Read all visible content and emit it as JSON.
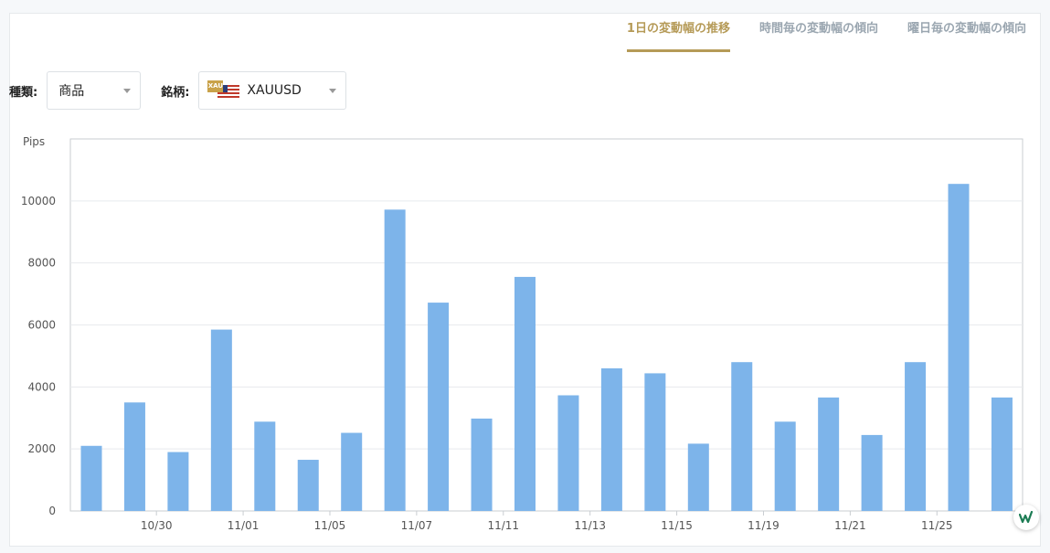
{
  "tabs": [
    {
      "label": "1日の変動幅の推移",
      "active": true
    },
    {
      "label": "時間毎の変動幅の傾向",
      "active": false
    },
    {
      "label": "曜日毎の変動幅の傾向",
      "active": false
    }
  ],
  "filters": {
    "type_label": "種類:",
    "type_value": "商品",
    "symbol_label": "銘柄:",
    "symbol_value": "XAUUSD",
    "symbol_badge": "XAU"
  },
  "colors": {
    "bar": "#7db4ea",
    "accent": "#b59a57"
  },
  "chart_data": {
    "type": "bar",
    "ylabel": "Pips",
    "ylim": [
      0,
      12000
    ],
    "yticks": [
      0,
      2000,
      4000,
      6000,
      8000,
      10000
    ],
    "grid": true,
    "values": [
      2100,
      3500,
      1900,
      5850,
      2880,
      1650,
      2520,
      9720,
      6720,
      2980,
      7550,
      3730,
      4600,
      4440,
      2170,
      4800,
      2880,
      3660,
      2450,
      4800,
      10550,
      3660
    ],
    "xticks": [
      {
        "label": "10/30",
        "pos": 1.5
      },
      {
        "label": "11/01",
        "pos": 3.5
      },
      {
        "label": "11/05",
        "pos": 5.5
      },
      {
        "label": "11/07",
        "pos": 7.5
      },
      {
        "label": "11/11",
        "pos": 9.5
      },
      {
        "label": "11/13",
        "pos": 11.5
      },
      {
        "label": "11/15",
        "pos": 13.5
      },
      {
        "label": "11/19",
        "pos": 15.5
      },
      {
        "label": "11/21",
        "pos": 17.5
      },
      {
        "label": "11/25",
        "pos": 19.5
      }
    ]
  }
}
